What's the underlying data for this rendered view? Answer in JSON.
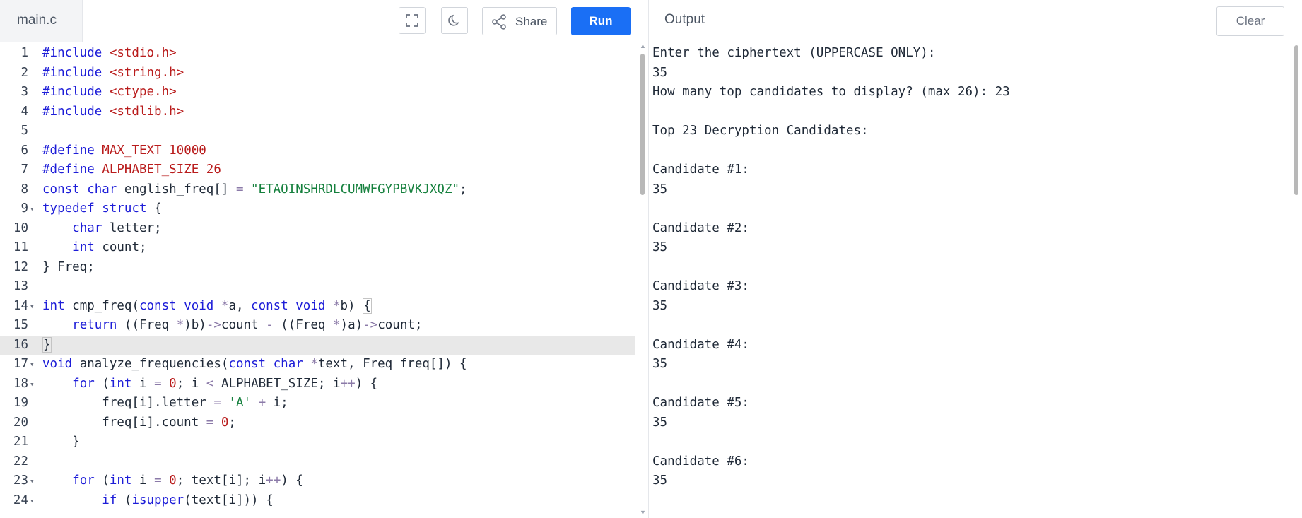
{
  "file_tab": {
    "label": "main.c"
  },
  "toolbar": {
    "fullscreen_icon": "fullscreen-icon",
    "theme_icon": "moon-icon",
    "share_label": "Share",
    "run_label": "Run"
  },
  "output_panel": {
    "title": "Output",
    "clear_label": "Clear"
  },
  "editor": {
    "active_line": 16,
    "lines": [
      {
        "n": "1",
        "fold": "",
        "tokens": [
          [
            "hdr-kw",
            "#include "
          ],
          [
            "hdr",
            "<stdio.h>"
          ]
        ]
      },
      {
        "n": "2",
        "fold": "",
        "tokens": [
          [
            "hdr-kw",
            "#include "
          ],
          [
            "hdr",
            "<string.h>"
          ]
        ]
      },
      {
        "n": "3",
        "fold": "",
        "tokens": [
          [
            "hdr-kw",
            "#include "
          ],
          [
            "hdr",
            "<ctype.h>"
          ]
        ]
      },
      {
        "n": "4",
        "fold": "",
        "tokens": [
          [
            "hdr-kw",
            "#include "
          ],
          [
            "hdr",
            "<stdlib.h>"
          ]
        ]
      },
      {
        "n": "5",
        "fold": "",
        "tokens": []
      },
      {
        "n": "6",
        "fold": "",
        "tokens": [
          [
            "kw",
            "#define "
          ],
          [
            "mac",
            "MAX_TEXT 10000"
          ]
        ]
      },
      {
        "n": "7",
        "fold": "",
        "tokens": [
          [
            "kw",
            "#define "
          ],
          [
            "mac",
            "ALPHABET_SIZE 26"
          ]
        ]
      },
      {
        "n": "8",
        "fold": "",
        "tokens": [
          [
            "kw",
            "const "
          ],
          [
            "kw",
            "char "
          ],
          [
            "t",
            "english_freq[] "
          ],
          [
            "op",
            "= "
          ],
          [
            "str",
            "\"ETAOINSHRDLCUMWFGYPBVKJXQZ\""
          ],
          [
            "t",
            ";"
          ]
        ]
      },
      {
        "n": "9",
        "fold": "▾",
        "tokens": [
          [
            "kw",
            "typedef "
          ],
          [
            "kw",
            "struct "
          ],
          [
            "t",
            "{"
          ]
        ]
      },
      {
        "n": "10",
        "fold": "",
        "tokens": [
          [
            "t",
            "    "
          ],
          [
            "kw",
            "char "
          ],
          [
            "t",
            "letter;"
          ]
        ]
      },
      {
        "n": "11",
        "fold": "",
        "tokens": [
          [
            "t",
            "    "
          ],
          [
            "kw",
            "int "
          ],
          [
            "t",
            "count;"
          ]
        ]
      },
      {
        "n": "12",
        "fold": "",
        "tokens": [
          [
            "t",
            "} Freq;"
          ]
        ]
      },
      {
        "n": "13",
        "fold": "",
        "tokens": []
      },
      {
        "n": "14",
        "fold": "▾",
        "tokens": [
          [
            "kw",
            "int "
          ],
          [
            "t",
            "cmp_freq("
          ],
          [
            "kw",
            "const "
          ],
          [
            "kw",
            "void "
          ],
          [
            "op",
            "*"
          ],
          [
            "t",
            "a, "
          ],
          [
            "kw",
            "const "
          ],
          [
            "kw",
            "void "
          ],
          [
            "op",
            "*"
          ],
          [
            "t",
            "b) "
          ],
          [
            "cur",
            "{"
          ]
        ]
      },
      {
        "n": "15",
        "fold": "",
        "tokens": [
          [
            "t",
            "    "
          ],
          [
            "kw",
            "return "
          ],
          [
            "t",
            "((Freq "
          ],
          [
            "op",
            "*"
          ],
          [
            "t",
            ")b)"
          ],
          [
            "op",
            "->"
          ],
          [
            "t",
            "count "
          ],
          [
            "op",
            "- "
          ],
          [
            "t",
            "((Freq "
          ],
          [
            "op",
            "*"
          ],
          [
            "t",
            ")a)"
          ],
          [
            "op",
            "->"
          ],
          [
            "t",
            "count;"
          ]
        ]
      },
      {
        "n": "16",
        "fold": "",
        "tokens": [
          [
            "cur",
            "}"
          ]
        ]
      },
      {
        "n": "17",
        "fold": "▾",
        "tokens": [
          [
            "kw",
            "void "
          ],
          [
            "t",
            "analyze_frequencies("
          ],
          [
            "kw",
            "const "
          ],
          [
            "kw",
            "char "
          ],
          [
            "op",
            "*"
          ],
          [
            "t",
            "text, Freq freq[]) {"
          ]
        ]
      },
      {
        "n": "18",
        "fold": "▾",
        "tokens": [
          [
            "t",
            "    "
          ],
          [
            "kw",
            "for "
          ],
          [
            "t",
            "("
          ],
          [
            "kw",
            "int "
          ],
          [
            "t",
            "i "
          ],
          [
            "op",
            "= "
          ],
          [
            "num",
            "0"
          ],
          [
            "t",
            "; i "
          ],
          [
            "op",
            "< "
          ],
          [
            "t",
            "ALPHABET_SIZE; i"
          ],
          [
            "op",
            "++"
          ],
          [
            "t",
            ") {"
          ]
        ]
      },
      {
        "n": "19",
        "fold": "",
        "tokens": [
          [
            "t",
            "        freq[i].letter "
          ],
          [
            "op",
            "= "
          ],
          [
            "str",
            "'A'"
          ],
          [
            "t",
            " "
          ],
          [
            "op",
            "+ "
          ],
          [
            "t",
            "i;"
          ]
        ]
      },
      {
        "n": "20",
        "fold": "",
        "tokens": [
          [
            "t",
            "        freq[i].count "
          ],
          [
            "op",
            "= "
          ],
          [
            "num",
            "0"
          ],
          [
            "t",
            ";"
          ]
        ]
      },
      {
        "n": "21",
        "fold": "",
        "tokens": [
          [
            "t",
            "    }"
          ]
        ]
      },
      {
        "n": "22",
        "fold": "",
        "tokens": []
      },
      {
        "n": "23",
        "fold": "▾",
        "tokens": [
          [
            "t",
            "    "
          ],
          [
            "kw",
            "for "
          ],
          [
            "t",
            "("
          ],
          [
            "kw",
            "int "
          ],
          [
            "t",
            "i "
          ],
          [
            "op",
            "= "
          ],
          [
            "num",
            "0"
          ],
          [
            "t",
            "; text[i]; i"
          ],
          [
            "op",
            "++"
          ],
          [
            "t",
            ") {"
          ]
        ]
      },
      {
        "n": "24",
        "fold": "▾",
        "tokens": [
          [
            "t",
            "        "
          ],
          [
            "kw",
            "if "
          ],
          [
            "t",
            "("
          ],
          [
            "kw",
            "isupper"
          ],
          [
            "t",
            "(text[i])) {"
          ]
        ]
      }
    ]
  },
  "output": {
    "lines": [
      "Enter the ciphertext (UPPERCASE ONLY):",
      "35",
      "How many top candidates to display? (max 26): 23",
      "",
      "Top 23 Decryption Candidates:",
      "",
      "Candidate #1:",
      "35",
      "",
      "Candidate #2:",
      "35",
      "",
      "Candidate #3:",
      "35",
      "",
      "Candidate #4:",
      "35",
      "",
      "Candidate #5:",
      "35",
      "",
      "Candidate #6:",
      "35"
    ]
  },
  "colors": {
    "run_button": "#1a6ff5",
    "keyword": "#1d1dd8",
    "string": "#15803d",
    "header": "#b91c1c",
    "active_line": "#e8e8e8"
  }
}
